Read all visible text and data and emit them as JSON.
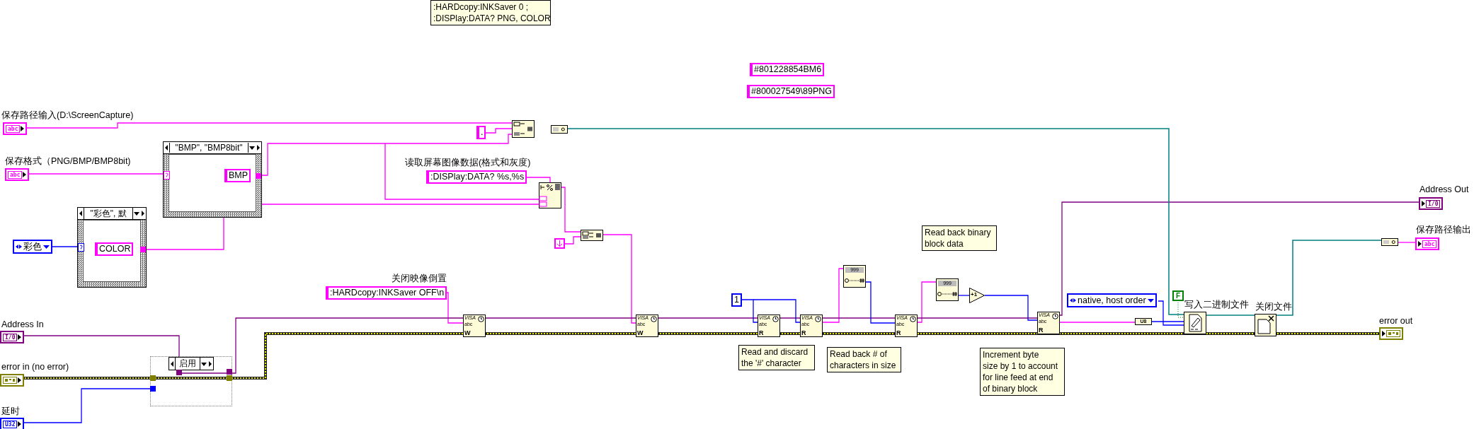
{
  "comments": [
    {
      "lines": [
        ":HARDcopy:INKSaver 0 ;",
        ":DISPlay:DATA? PNG, COLOR"
      ]
    },
    {
      "lines": [
        "Read back binary",
        "block data"
      ]
    },
    {
      "lines": [
        "Read and discard",
        "the '#' character"
      ]
    },
    {
      "lines": [
        "Read back # of",
        "characters in size"
      ]
    },
    {
      "lines": [
        "Increment byte",
        "size by 1 to account",
        "for line feed at end",
        "of binary block"
      ]
    }
  ],
  "string_constants": [
    "#801228854BM6",
    "#800027549\\89PNG",
    ".",
    "BMP",
    ":DISPlay:DATA? %s,%s",
    "COLOR",
    ":HARDcopy:INKSaver OFF\\n"
  ],
  "labels": [
    "读取屏幕图像数据(格式和灰度)",
    "关闭映像倒置",
    "写入二进制文件",
    "关闭文件"
  ],
  "terminals": [
    {
      "label": "保存路径输入(D:\\ScreenCapture)",
      "kind": "string",
      "type_text": "abc",
      "indicator": false
    },
    {
      "label": "保存格式（PNG/BMP/BMP8bit)",
      "kind": "string",
      "type_text": "abc",
      "indicator": false
    },
    {
      "label": "Address In",
      "kind": "visa",
      "type_text": "I/0",
      "indicator": false
    },
    {
      "label": "error in (no error)",
      "kind": "error",
      "indicator": false
    },
    {
      "label": "延时",
      "kind": "u32",
      "type_text": "U32",
      "indicator": false
    },
    {
      "label": "Address Out",
      "kind": "visa",
      "type_text": "I/0",
      "indicator": true
    },
    {
      "label": "保存路径输出",
      "kind": "string",
      "type_text": "abc",
      "indicator": true
    },
    {
      "label": "error out",
      "kind": "error",
      "indicator": true
    }
  ],
  "case_structures": [
    {
      "selector": "\"BMP\", \"BMP8bit\""
    },
    {
      "selector": "\"彩色\", 默"
    }
  ],
  "enum_constants": [
    "彩色",
    "native, host order"
  ],
  "numeric_constant": "1",
  "boolean_constant": "F",
  "disable_structure": {
    "selector": "启用"
  },
  "nodes": [
    {
      "kind": "visa",
      "caption": "VISA",
      "type": "abc",
      "mode": "W"
    },
    {
      "kind": "visa",
      "caption": "VISA",
      "type": "abc",
      "mode": "W"
    },
    {
      "kind": "visa",
      "caption": "VISA",
      "type": "abc",
      "mode": "R"
    },
    {
      "kind": "visa",
      "caption": "VISA",
      "type": "abc",
      "mode": "R"
    },
    {
      "kind": "visa",
      "caption": "VISA",
      "type": "abc",
      "mode": "R"
    },
    {
      "kind": "visa",
      "caption": "VISA",
      "type": "abc",
      "mode": "R"
    },
    {
      "kind": "scan",
      "format": "999"
    },
    {
      "kind": "scan",
      "format": "999"
    },
    {
      "kind": "concat"
    },
    {
      "kind": "to_path"
    },
    {
      "kind": "format"
    },
    {
      "kind": "concat"
    },
    {
      "kind": "linefeed"
    },
    {
      "kind": "increment",
      "text": "+1"
    },
    {
      "kind": "typecast",
      "text": "U8"
    },
    {
      "kind": "write_file"
    },
    {
      "kind": "close_file"
    },
    {
      "kind": "to_string"
    }
  ]
}
